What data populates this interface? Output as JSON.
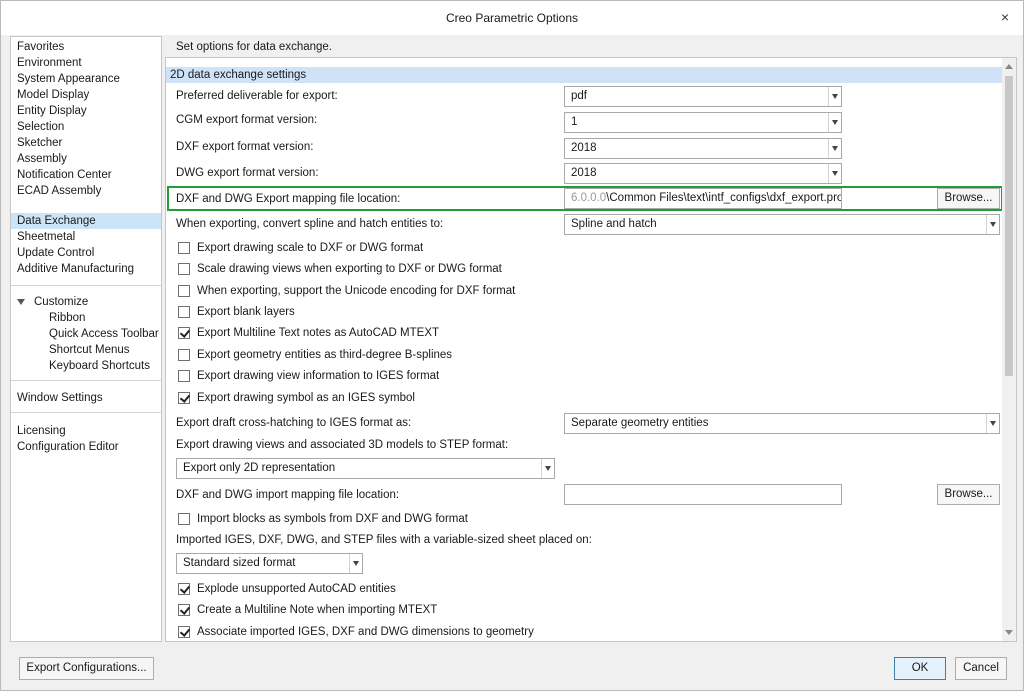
{
  "window": {
    "title": "Creo Parametric Options",
    "close_glyph": "×"
  },
  "nav": {
    "groups": [
      [
        "Favorites",
        "Environment",
        "System Appearance",
        "Model Display",
        "Entity Display",
        "Selection",
        "Sketcher",
        "Assembly",
        "Notification Center",
        "ECAD Assembly",
        "Data Exchange",
        "Sheetmetal",
        "Update Control",
        "Additive Manufacturing"
      ],
      [
        "Customize",
        "Ribbon",
        "Quick Access Toolbar",
        "Shortcut Menus",
        "Keyboard Shortcuts"
      ],
      [
        "Window Settings"
      ],
      [
        "Licensing",
        "Configuration Editor"
      ]
    ],
    "selected": "Data Exchange"
  },
  "panel": {
    "header": "Set options for data exchange.",
    "section_title": "2D data exchange settings",
    "preferred_label": "Preferred deliverable for export:",
    "preferred_value": "pdf",
    "cgm_label": "CGM export format version:",
    "cgm_value": "1",
    "dxf_label": "DXF export format version:",
    "dxf_value": "2018",
    "dwg_label": "DWG export format version:",
    "dwg_value": "2018",
    "mapping_label": "DXF and DWG Export mapping file location:",
    "mapping_value_dim": "6.0.0.0",
    "mapping_value": "\\Common Files\\text\\intf_configs\\dxf_export.pro",
    "browse_label": "Browse...",
    "spline_label": "When exporting, convert spline and hatch entities to:",
    "spline_value": "Spline and hatch",
    "export_checks": [
      {
        "label": "Export drawing scale to DXF or DWG format",
        "checked": false
      },
      {
        "label": "Scale drawing views when exporting to DXF or DWG format",
        "checked": false
      },
      {
        "label": "When exporting, support the Unicode encoding for DXF format",
        "checked": false
      },
      {
        "label": "Export blank layers",
        "checked": false
      },
      {
        "label": "Export Multiline Text notes as AutoCAD MTEXT",
        "checked": true
      },
      {
        "label": "Export geometry entities as third-degree B-splines",
        "checked": false
      },
      {
        "label": "Export drawing view information to IGES format",
        "checked": false
      },
      {
        "label": "Export drawing symbol as an IGES symbol",
        "checked": true
      }
    ],
    "crosshatch_label": "Export draft cross-hatching to IGES format as:",
    "crosshatch_value": "Separate geometry entities",
    "step_label": "Export drawing views and associated 3D models to STEP format:",
    "step_value": "Export only 2D representation",
    "import_mapping_label": "DXF and DWG import mapping file location:",
    "import_mapping_value": "",
    "import_blocks_label": "Import blocks as symbols from DXF and DWG format",
    "import_blocks_checked": false,
    "sheet_label": "Imported IGES, DXF, DWG, and STEP files with a variable-sized sheet placed on:",
    "sheet_value": "Standard sized format",
    "import_checks": [
      {
        "label": "Explode unsupported AutoCAD entities",
        "checked": true
      },
      {
        "label": "Create a Multiline Note when importing MTEXT",
        "checked": true
      },
      {
        "label": "Associate imported IGES, DXF and DWG dimensions to geometry",
        "checked": true
      }
    ]
  },
  "footer": {
    "export_config": "Export Configurations...",
    "ok": "OK",
    "cancel": "Cancel"
  },
  "colors": {
    "selection": "#cce4f7",
    "section_bar": "#cfe2f8",
    "highlight_box": "#1f9d3a"
  }
}
